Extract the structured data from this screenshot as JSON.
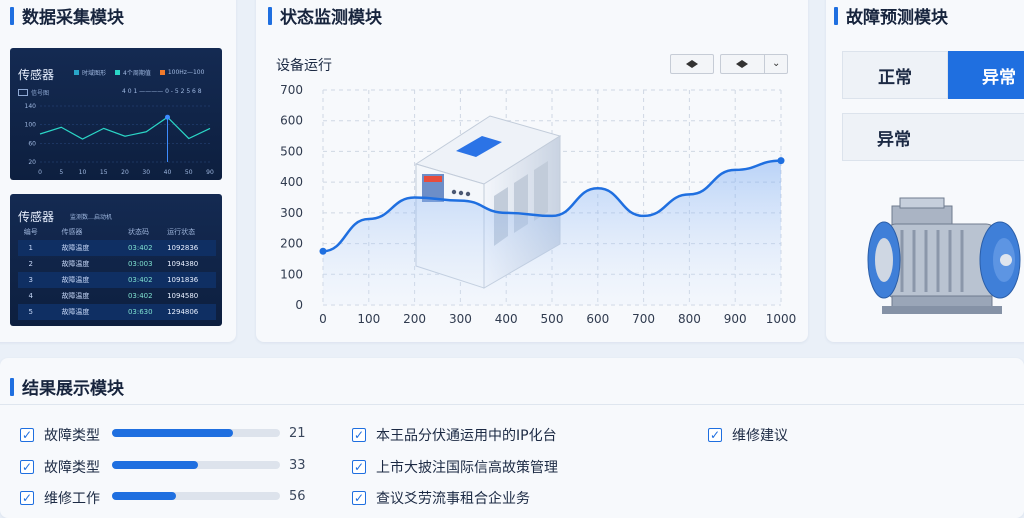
{
  "modules": {
    "collect": "数据采集模块",
    "monitor": "状态监测模块",
    "predict": "故障预测模块",
    "result": "结果展示模块"
  },
  "sensor_card1": {
    "title": "传感器",
    "legend": [
      "时域图形",
      "4个周期值",
      "100Hz—100"
    ],
    "legend_colors": [
      "#29a6c9",
      "#2bd6c6",
      "#f07a2c"
    ],
    "sub": "信号图",
    "ticks_top": "4 0 1 ———— 0 - 5 2 5 6 8",
    "y_ticks": [
      "140",
      "100",
      "60",
      "20"
    ],
    "x_ticks": [
      "0",
      "5",
      "10",
      "15",
      "20",
      "30",
      "40",
      "50",
      "90"
    ],
    "line_values": [
      50,
      62,
      41,
      60,
      46,
      54,
      80,
      42,
      60
    ]
  },
  "sensor_card2": {
    "title": "传感器",
    "subtitle": "监测数…启动机",
    "headers": [
      "编号",
      "传感器",
      "状态码",
      "运行状态"
    ],
    "rows": [
      [
        "1",
        "故障温度",
        "03:402",
        "1092836"
      ],
      [
        "2",
        "故障温度",
        "03:003",
        "1094380"
      ],
      [
        "3",
        "故障温度",
        "03:402",
        "1091836"
      ],
      [
        "4",
        "故障温度",
        "03:402",
        "1094580"
      ],
      [
        "5",
        "故障温度",
        "03:630",
        "1294806"
      ]
    ]
  },
  "monitor_chart": {
    "label": "设备运行"
  },
  "chart_data": {
    "type": "area",
    "title": "设备运行",
    "x": [
      0,
      100,
      200,
      300,
      400,
      500,
      600,
      700,
      800,
      900,
      1000
    ],
    "y": [
      175,
      280,
      350,
      340,
      300,
      290,
      380,
      290,
      360,
      440,
      470
    ],
    "y_ticks": [
      0,
      100,
      200,
      300,
      400,
      500,
      600,
      700
    ],
    "x_ticks": [
      0,
      100,
      200,
      300,
      400,
      500,
      600,
      700,
      800,
      900,
      1000
    ],
    "xlim": [
      0,
      1000
    ],
    "ylim": [
      0,
      700
    ],
    "line_color": "#1f6fe0",
    "grid": true
  },
  "predict": {
    "normal": "正常",
    "abnormal_active": "异常",
    "abnormal": "异常",
    "accent": "#1f6fe0"
  },
  "results": {
    "left": [
      {
        "label": "故障类型",
        "value": "21",
        "fraction": 0.72
      },
      {
        "label": "故障类型",
        "value": "33",
        "fraction": 0.51
      },
      {
        "label": "维修工作",
        "value": "56",
        "fraction": 0.38
      }
    ],
    "middle": [
      "本王品分伏通运用中的IP化台",
      "上市大披注国际信高故策管理",
      "查议爻劳流事租合企业务"
    ],
    "right": [
      "维修建议"
    ]
  }
}
